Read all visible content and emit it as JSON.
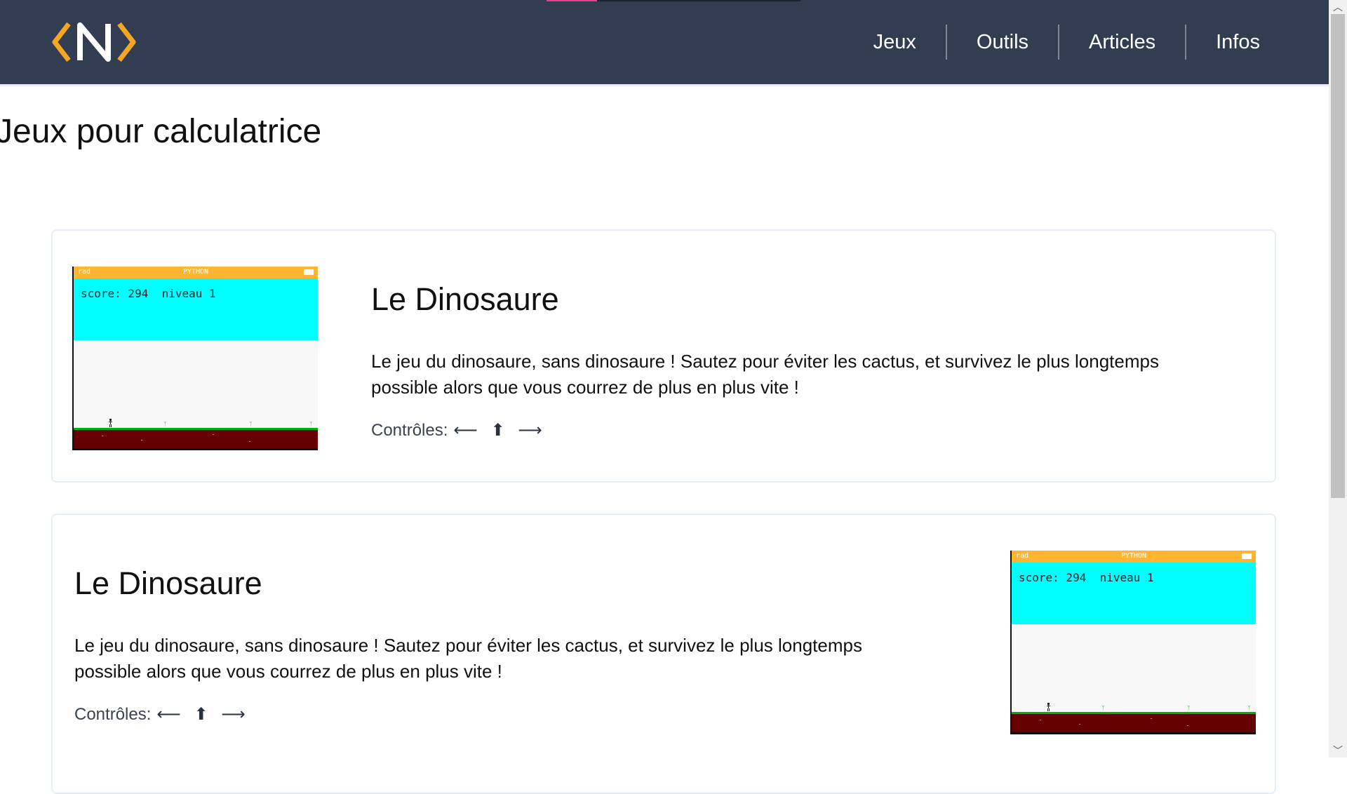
{
  "header": {
    "logo_alt": "logo",
    "nav": [
      {
        "label": "Jeux"
      },
      {
        "label": "Outils"
      },
      {
        "label": "Articles"
      },
      {
        "label": "Infos"
      }
    ],
    "reading_progress": 0.2,
    "colors": {
      "bar_bg": "#333d52",
      "logo_accent": "#f5a623",
      "progress": "#e83e8c"
    }
  },
  "page": {
    "title": "Jeux pour calculatrice"
  },
  "games": [
    {
      "title": "Le Dinosaure",
      "description": "Le jeu du dinosaure, sans dinosaure ! Sautez pour éviter les cactus, et survivez le plus longtemps possible alors que vous courrez de plus en plus vite !",
      "controls_label": "Contrôles:",
      "controls_keys": "⟵ ⬆ ⟶",
      "screen": {
        "status_left": "rad",
        "status_center": "PYTHON",
        "score_text": "score: 294  niveau 1"
      }
    },
    {
      "title": "Le Dinosaure",
      "description": "Le jeu du dinosaure, sans dinosaure ! Sautez pour éviter les cactus, et survivez le plus longtemps possible alors que vous courrez de plus en plus vite !",
      "controls_label": "Contrôles:",
      "controls_keys": "⟵ ⬆ ⟶",
      "screen": {
        "status_left": "rad",
        "status_center": "PYTHON",
        "score_text": "score: 294  niveau 1"
      }
    }
  ]
}
